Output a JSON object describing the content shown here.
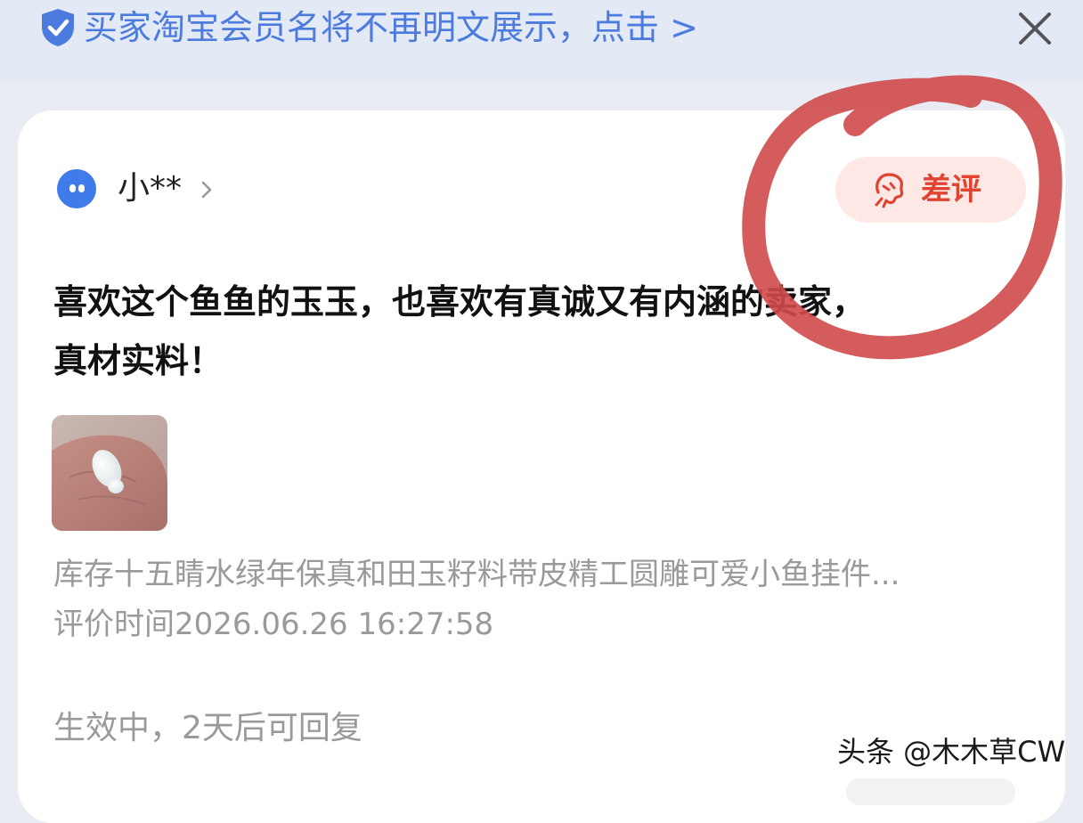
{
  "notice": {
    "text": "买家淘宝会员名将不再明文展示，点击 >",
    "close_icon": "close-icon",
    "shield_icon": "shield-check-icon"
  },
  "review": {
    "reviewer_name": "小**",
    "rating_badge": "差评",
    "content_line1": "喜欢这个鱼鱼的玉玉，也喜欢有真诚又有内涵的卖家，",
    "content_line2": "真材实料！",
    "product_title": "库存十五睛水绿年保真和田玉籽料带皮精工圆雕可爱小鱼挂件...",
    "review_time": "评价时间2026.06.26 16:27:58",
    "status": "生效中，2天后可回复"
  },
  "watermark": "头条 @木木草CW",
  "colors": {
    "accent_blue": "#4c7be0",
    "bad_red": "#e0432f",
    "annotation_red": "#d04a4a"
  }
}
